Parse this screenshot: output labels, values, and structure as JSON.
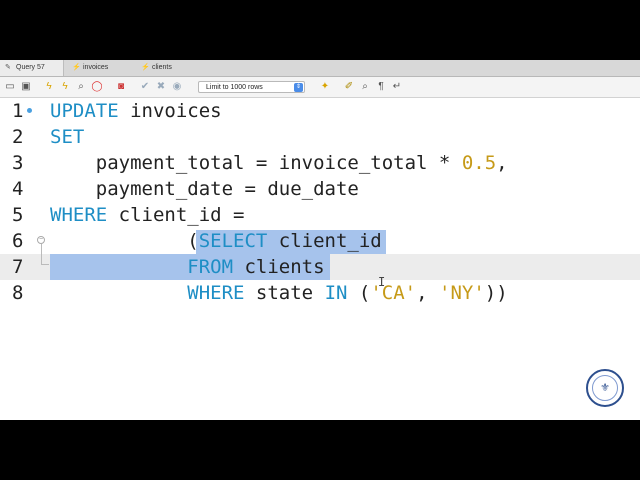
{
  "tabs": [
    {
      "label": "Query 57",
      "active": true
    },
    {
      "label": "invoices",
      "active": false
    },
    {
      "label": "clients",
      "active": false
    }
  ],
  "toolbar": {
    "icons": [
      "open-folder-icon",
      "save-icon",
      "execute-lightning-icon",
      "execute-current-icon",
      "explain-icon",
      "stop-icon",
      "toggle-output-icon",
      "commit-check-icon",
      "rollback-x-icon",
      "autocommit-icon",
      "beautify-icon",
      "find-icon",
      "invisible-chars-icon",
      "wrap-lines-icon"
    ],
    "limit_label": "Limit to 1000 rows"
  },
  "editor": {
    "line_numbers": [
      "1",
      "2",
      "3",
      "4",
      "5",
      "6",
      "7",
      "8"
    ],
    "current_line": 7,
    "selection": "SELECT client_id / FROM clients",
    "tokens": {
      "l1_kw": "UPDATE",
      "l1_rest": " invoices",
      "l2_kw": "SET",
      "l3_a": "    payment_total = invoice_total * ",
      "l3_num": "0.5",
      "l3_end": ",",
      "l4_a": "    payment_date = due_date",
      "l5_kw": "WHERE",
      "l5_rest": " client_id =",
      "l6_a": "            (",
      "l6_kw": "SELECT",
      "l6_rest": " client_id",
      "l7_a": "            ",
      "l7_kw": "FROM",
      "l7_rest": " clients",
      "l8_a": "            ",
      "l8_kw1": "WHERE",
      "l8_b": " state ",
      "l8_kw2": "IN",
      "l8_c": " (",
      "l8_s1": "'CA'",
      "l8_d": ", ",
      "l8_s2": "'NY'",
      "l8_e": "))"
    }
  },
  "colors": {
    "keyword": "#1e8ec5",
    "literal": "#c69a18",
    "selection": "#a6c3ec",
    "current_line": "#ececec"
  }
}
